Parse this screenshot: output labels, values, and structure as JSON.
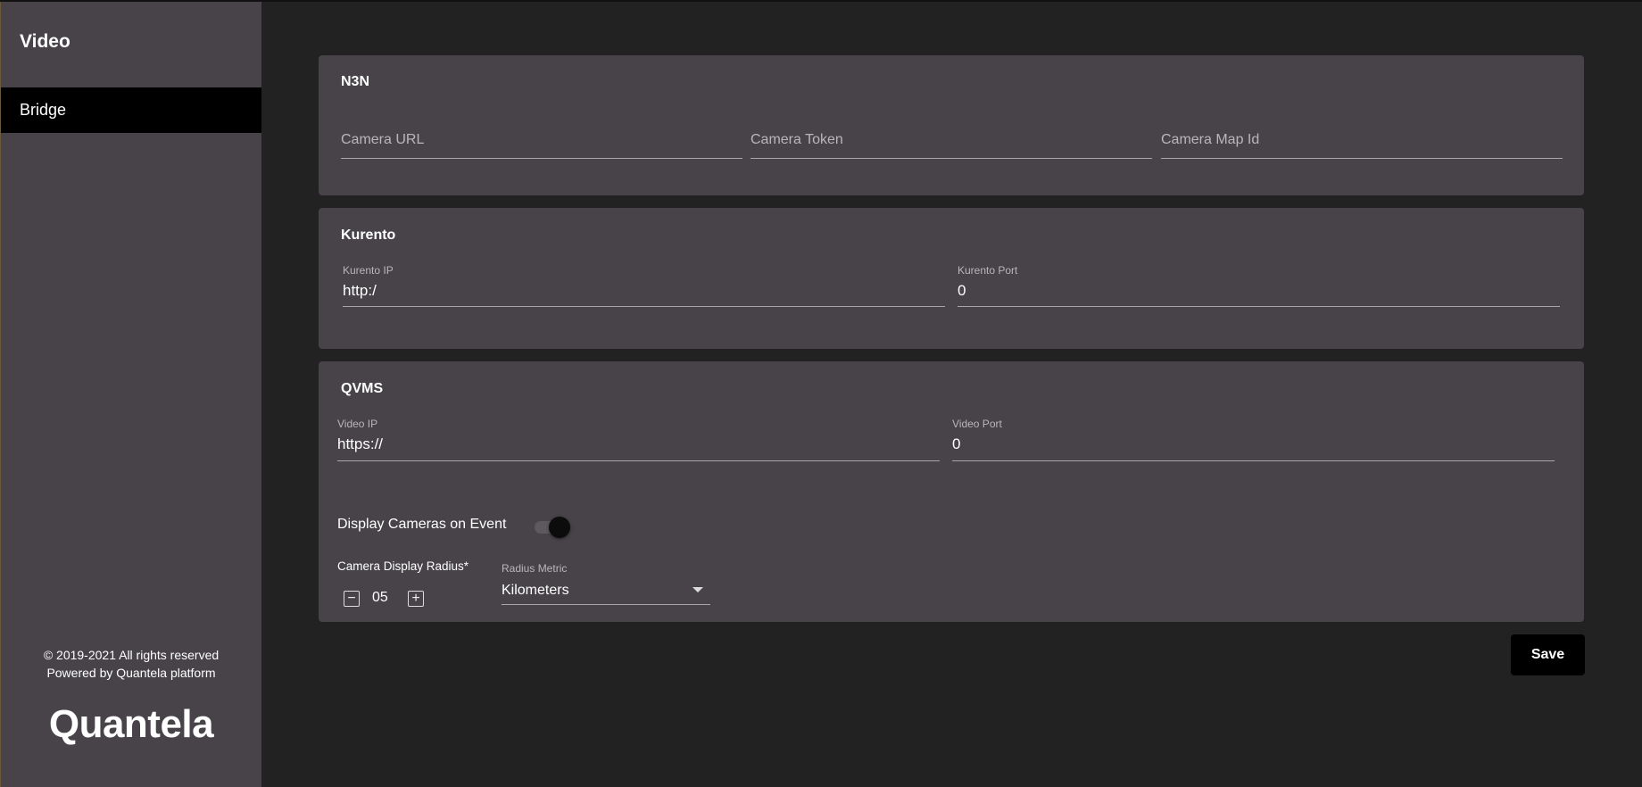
{
  "sidebar": {
    "title": "Video",
    "items": [
      {
        "label": "Bridge"
      }
    ],
    "footer": {
      "copyright": "© 2019-2021 All rights reserved",
      "powered_by": "Powered by Quantela platform"
    },
    "logo_text": "Quantela"
  },
  "n3n": {
    "title": "N3N",
    "camera_url": {
      "placeholder": "Camera URL",
      "value": ""
    },
    "camera_token": {
      "placeholder": "Camera Token",
      "value": ""
    },
    "camera_map_id": {
      "placeholder": "Camera Map Id",
      "value": ""
    }
  },
  "kurento": {
    "title": "Kurento",
    "ip": {
      "label": "Kurento IP",
      "value": "http:/"
    },
    "port": {
      "label": "Kurento Port",
      "value": "0"
    }
  },
  "qvms": {
    "title": "QVMS",
    "video_ip": {
      "label": "Video IP",
      "value": "https://"
    },
    "video_port": {
      "label": "Video Port",
      "value": "0"
    },
    "display_cameras": {
      "label": "Display Cameras on Event",
      "enabled": true
    },
    "radius": {
      "label": "Camera Display Radius*",
      "value": "05",
      "minus_symbol": "−",
      "plus_symbol": "+"
    },
    "radius_metric": {
      "label": "Radius Metric",
      "selected": "Kilometers"
    }
  },
  "actions": {
    "save_label": "Save"
  },
  "colors": {
    "background": "#222222",
    "panel": "#474349",
    "selected_nav": "#000000",
    "button": "#000000"
  }
}
